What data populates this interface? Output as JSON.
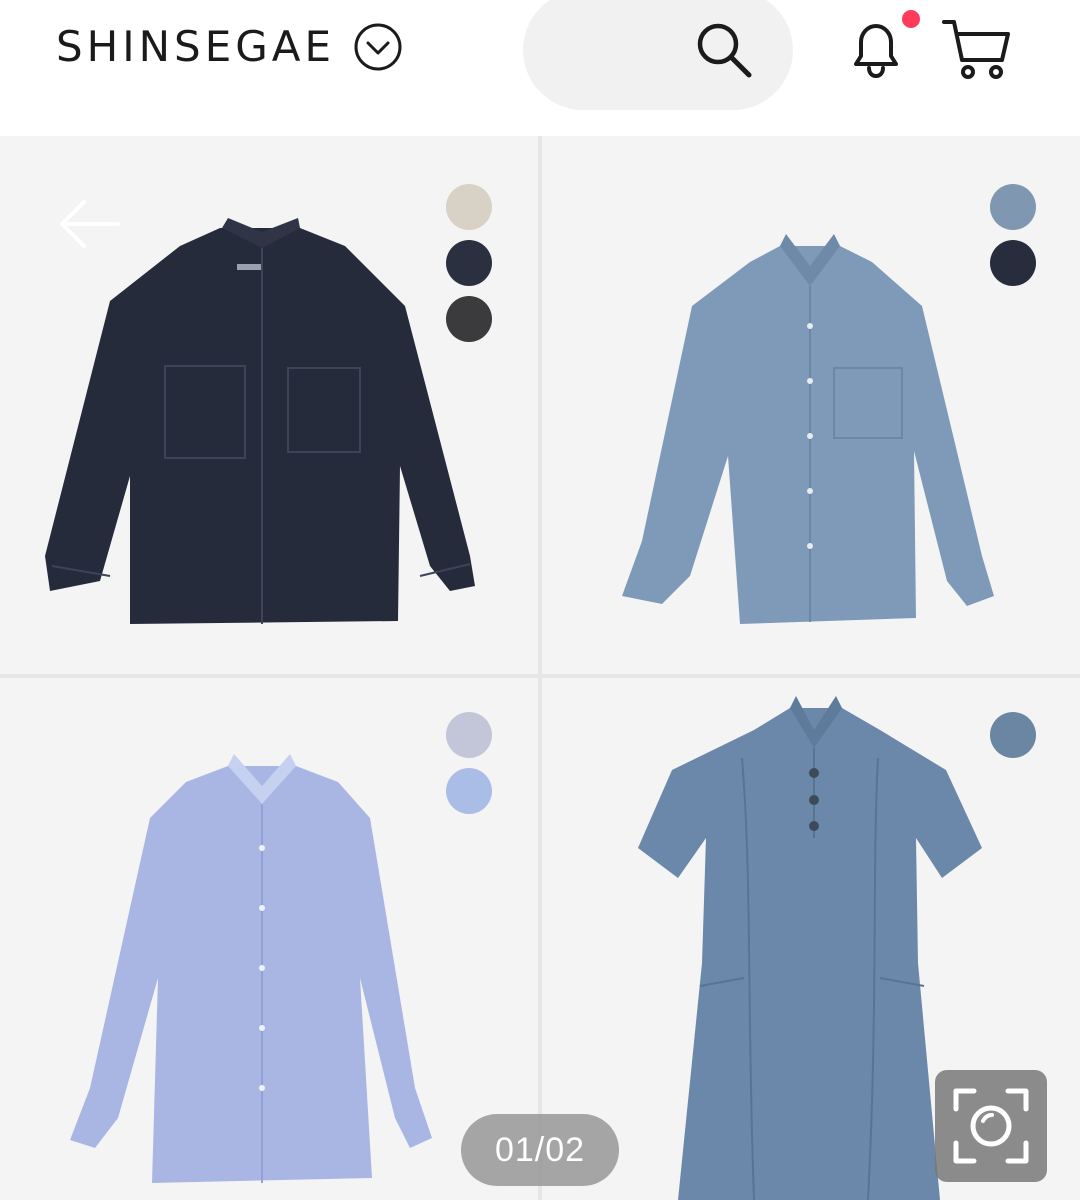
{
  "header": {
    "brand": "SHINSEGAE",
    "icons": {
      "brand_toggle": "chevron-down-circle-icon",
      "search": "search-icon",
      "notifications": "bell-icon",
      "cart": "cart-icon"
    },
    "has_notification": true
  },
  "colors": {
    "notification_dot": "#ff3b5c",
    "card_background": "#f4f4f4",
    "grid_divider": "#e6e6e6"
  },
  "products": [
    {
      "name": "dark-denim-shirt-jacket",
      "swatches": [
        "#d8d2c6",
        "#2b3040",
        "#3b3b3d"
      ]
    },
    {
      "name": "light-denim-shirt",
      "swatches": [
        "#7f97b0",
        "#272d3d"
      ]
    },
    {
      "name": "blue-striped-shirt",
      "swatches": [
        "#c2c6d8",
        "#a9bde6"
      ]
    },
    {
      "name": "denim-shirt-dress",
      "swatches": [
        "#6b86a3"
      ]
    }
  ],
  "pager": {
    "text": "01/02"
  },
  "lens": {
    "icon": "image-search-lens-icon"
  }
}
